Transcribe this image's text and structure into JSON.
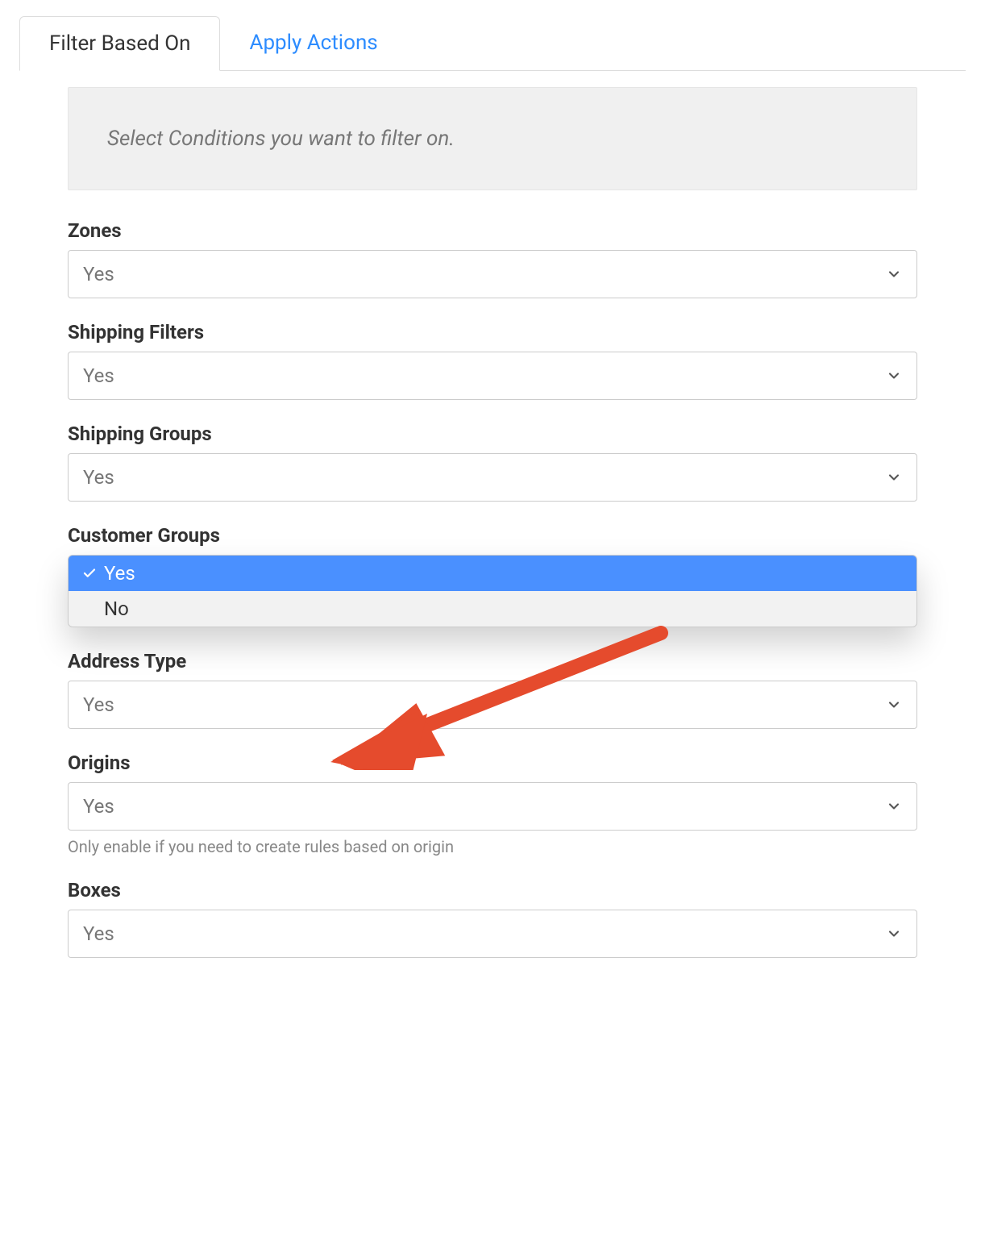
{
  "tabs": {
    "filter_based_on": "Filter Based On",
    "apply_actions": "Apply Actions"
  },
  "banner": {
    "text": "Select Conditions you want to filter on."
  },
  "fields": {
    "zones": {
      "label": "Zones",
      "value": "Yes"
    },
    "shipping_filters": {
      "label": "Shipping Filters",
      "value": "Yes"
    },
    "shipping_groups": {
      "label": "Shipping Groups",
      "value": "Yes"
    },
    "customer_groups": {
      "label": "Customer Groups",
      "options": {
        "yes": "Yes",
        "no": "No"
      },
      "selected": "Yes"
    },
    "address_type": {
      "label": "Address Type",
      "value": "Yes"
    },
    "origins": {
      "label": "Origins",
      "value": "Yes",
      "helper": "Only enable if you need to create rules based on origin"
    },
    "boxes": {
      "label": "Boxes",
      "value": "Yes"
    }
  },
  "colors": {
    "accent_blue": "#2d8cff",
    "highlight_blue": "#4a90ff",
    "arrow_red": "#e54b2d"
  }
}
